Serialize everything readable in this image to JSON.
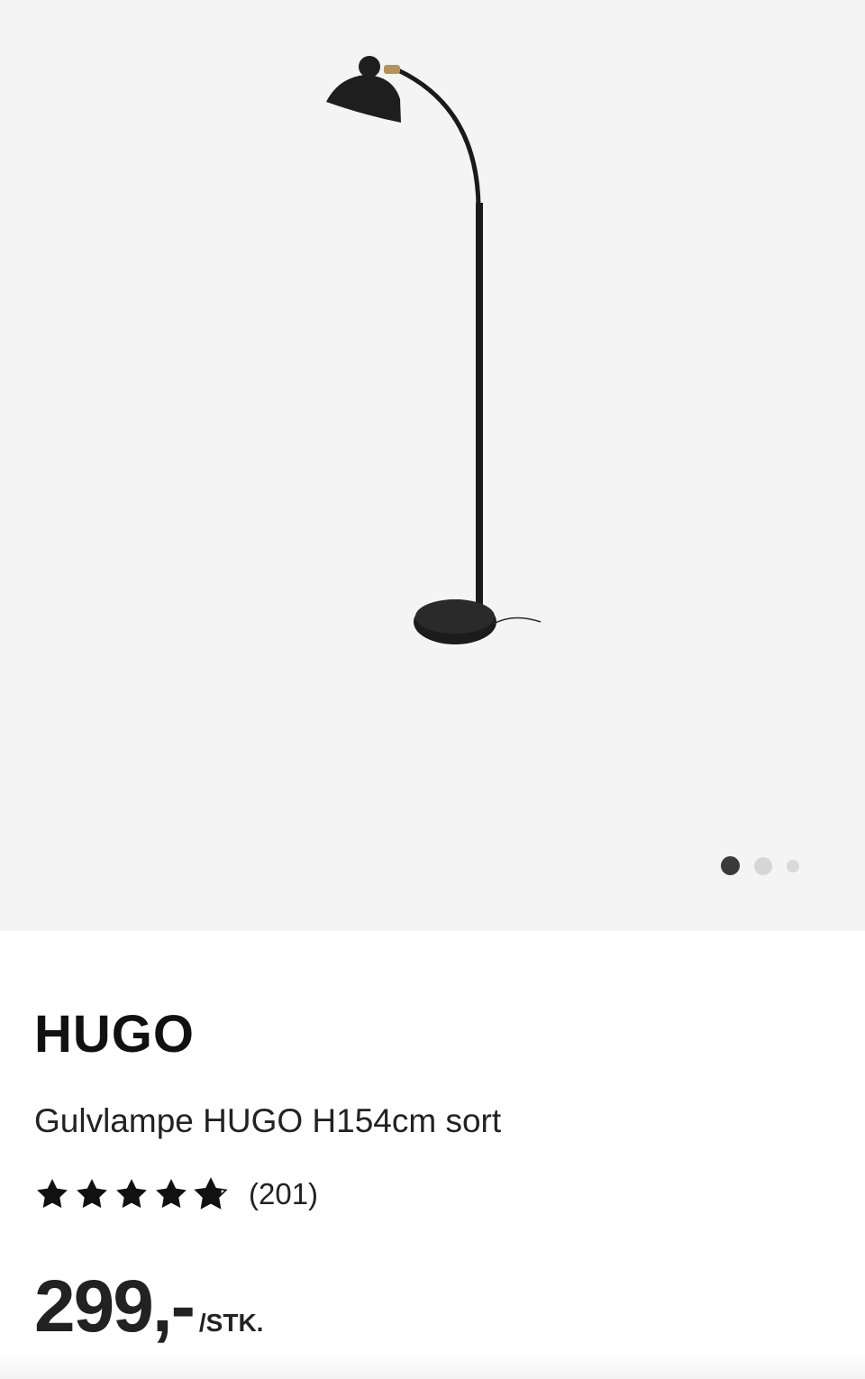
{
  "gallery": {
    "image": "floor-lamp-image",
    "dots": 3,
    "active_dot": 1
  },
  "product": {
    "brand": "HUGO",
    "description": "Gulvlampe HUGO H154cm sort",
    "rating": {
      "stars": 4.8,
      "max": 5,
      "count_label": "(201)"
    },
    "price": {
      "value": "299,-",
      "unit": "/STK."
    }
  },
  "colors": {
    "gallery_bg": "#f4f4f4",
    "text": "#111111",
    "dot_active": "#3a3a3a",
    "dot_inactive": "#d6d6d6"
  }
}
